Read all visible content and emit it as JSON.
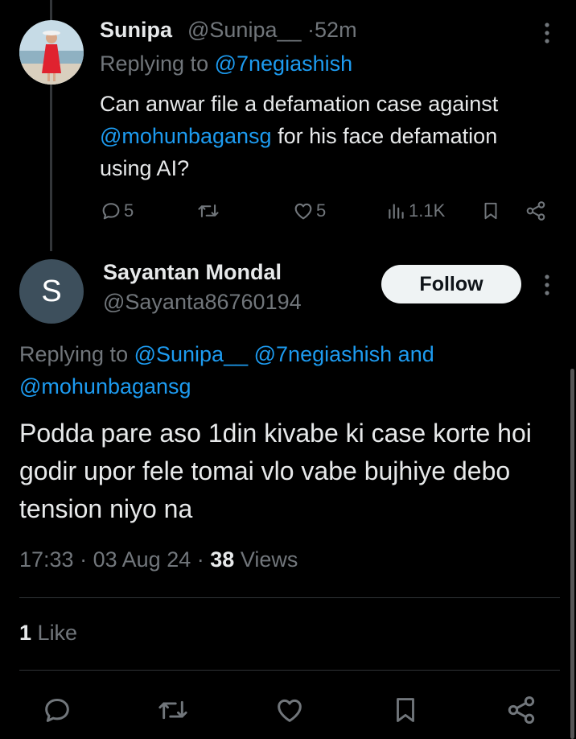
{
  "tweet1": {
    "name": "Sunipa",
    "handle": "@Sunipa__",
    "separator": "·",
    "time": "52m",
    "replying_prefix": "Replying to ",
    "replying_to": "@7negiashish",
    "text_parts": {
      "a": "Can anwar file a defamation case against ",
      "mention": "@mohunbagansg",
      "b": " for his face defamation using AI?"
    },
    "stats": {
      "replies": "5",
      "likes": "5",
      "views": "1.1K"
    },
    "icons": [
      "more-icon",
      "reply-icon",
      "retweet-icon",
      "like-icon",
      "views-icon",
      "bookmark-icon",
      "share-icon"
    ]
  },
  "tweet2": {
    "name": "Sayantan Mondal",
    "handle": "@Sayanta86760194",
    "avatar_letter": "S",
    "follow_label": "Follow",
    "replying_prefix": "Replying to ",
    "replying_mention_1": "@Sunipa__",
    "replying_mention_2": "@7negiashish",
    "replying_and": "and",
    "replying_mention_3": "@mohunbagansg",
    "text": "Podda pare aso 1din kivabe ki case korte hoi godir upor fele tomai vlo vabe bujhiye debo tension niyo na",
    "time": "17:33",
    "date": "03 Aug 24",
    "views_count": "38",
    "views_label": "Views",
    "likes_count": "1",
    "likes_label": "Like"
  },
  "colors": {
    "background": "#000000",
    "text": "#e7e9ea",
    "muted": "#71767b",
    "link": "#1d9bf0",
    "avatar_bg": "#3d4f5c",
    "follow_bg": "#eff3f4"
  }
}
